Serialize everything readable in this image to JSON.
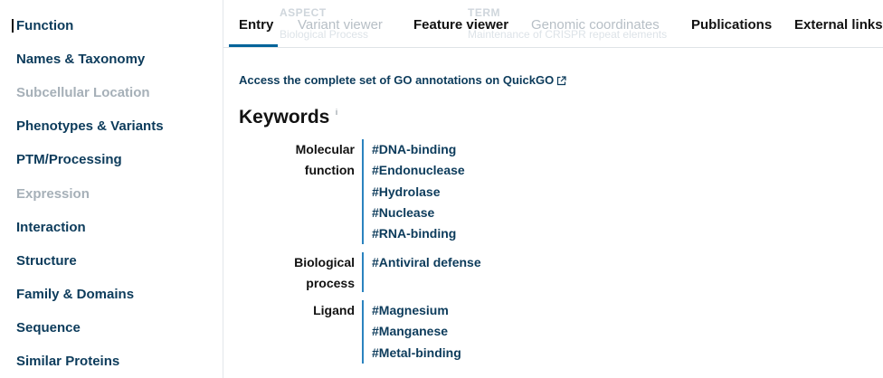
{
  "sidebar": {
    "items": [
      {
        "label": "Function",
        "enabled": true
      },
      {
        "label": "Names & Taxonomy",
        "enabled": true
      },
      {
        "label": "Subcellular Location",
        "enabled": false
      },
      {
        "label": "Phenotypes & Variants",
        "enabled": true
      },
      {
        "label": "PTM/Processing",
        "enabled": true
      },
      {
        "label": "Expression",
        "enabled": false
      },
      {
        "label": "Interaction",
        "enabled": true
      },
      {
        "label": "Structure",
        "enabled": true
      },
      {
        "label": "Family & Domains",
        "enabled": true
      },
      {
        "label": "Sequence",
        "enabled": true
      },
      {
        "label": "Similar Proteins",
        "enabled": true
      }
    ]
  },
  "tabs": {
    "items": [
      {
        "label": "Entry",
        "enabled": true,
        "active": true
      },
      {
        "label": "Variant viewer",
        "enabled": false
      },
      {
        "label": "Feature viewer",
        "enabled": true
      },
      {
        "label": "Genomic coordinates",
        "enabled": false
      },
      {
        "label": "Publications",
        "enabled": true
      },
      {
        "label": "External links",
        "enabled": true
      }
    ],
    "ghost_column_1": "ASPECT",
    "ghost_column_2": "TERM",
    "ghost_text_1": "Biological Process",
    "ghost_text_2": "Maintenance of CRISPR repeat elements"
  },
  "go": {
    "quickgo_link": "Access the complete set of GO annotations on QuickGO",
    "external_link_icon": "external-link-icon"
  },
  "keywords": {
    "heading": "Keywords",
    "info_marker": "i",
    "groups": [
      {
        "label_line1": "Molecular",
        "label_line2": "function",
        "terms": [
          "#DNA-binding",
          "#Endonuclease",
          "#Hydrolase",
          "#Nuclease",
          "#RNA-binding"
        ]
      },
      {
        "label_line1": "Biological",
        "label_line2": "process",
        "terms": [
          "#Antiviral defense"
        ]
      },
      {
        "label_line1": "Ligand",
        "label_line2": "",
        "terms": [
          "#Magnesium",
          "#Manganese",
          "#Metal-binding"
        ]
      }
    ]
  },
  "colors": {
    "link": "#0c3b5b",
    "accent": "#00639a",
    "rule": "#2a83bf",
    "disabled": "#a6b0b8"
  }
}
